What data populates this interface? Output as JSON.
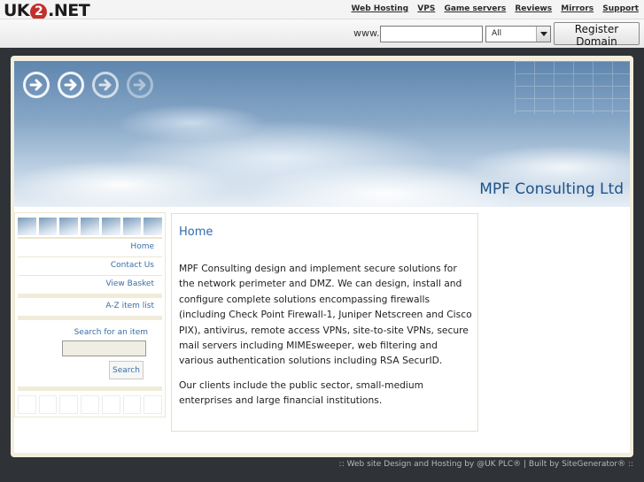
{
  "header": {
    "logo_prefix": "UK",
    "logo_digit": "2",
    "logo_suffix": ".NET",
    "nav": [
      "Web Hosting",
      "VPS",
      "Game servers",
      "Reviews",
      "Mirrors",
      "Support"
    ]
  },
  "domain_search": {
    "prefix_label": "www.",
    "input_value": "",
    "tld_selected": "All",
    "button_label": "Register Domain"
  },
  "banner": {
    "title": "MPF Consulting Ltd",
    "arrow_icons": [
      "arrow-right-icon",
      "arrow-right-icon",
      "arrow-right-icon",
      "arrow-right-icon"
    ]
  },
  "sidebar": {
    "links": [
      "Home",
      "Contact Us",
      "View Basket",
      "A-Z item list"
    ],
    "search_label": "Search for an item",
    "search_value": "",
    "search_button": "Search"
  },
  "content": {
    "title": "Home",
    "paragraph1": "MPF Consulting design and implement secure solutions for the network perimeter and DMZ. We can design, install and configure complete solutions encompassing firewalls (including Check Point Firewall-1, Juniper Netscreen and Cisco PIX), antivirus, remote access VPNs, site-to-site VPNs, secure mail servers including MIMEsweeper, web filtering and various authentication solutions including RSA SecurID.",
    "paragraph2": "Our clients include the public sector, small-medium enterprises and large financial institutions."
  },
  "footer": {
    "text": ":: Web site Design and Hosting by @UK PLC® | Built by SiteGenerator® ::"
  },
  "colors": {
    "accent_blue": "#2f6aa8",
    "logo_red": "#c2302d",
    "frame_cream": "#f2eedd",
    "background_dark": "#2f3236"
  }
}
